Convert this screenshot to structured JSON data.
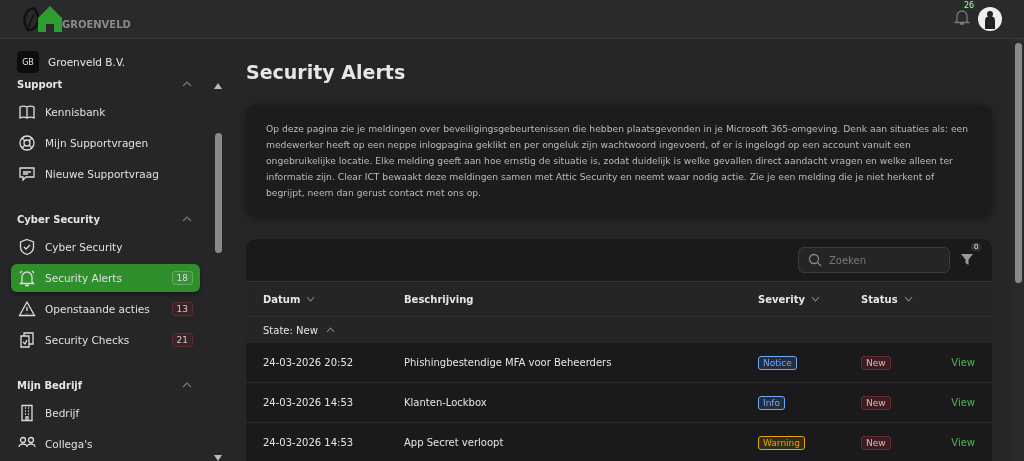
{
  "brand": {
    "name": "GROENVELD"
  },
  "topbar": {
    "notification_count": "26"
  },
  "organization": {
    "initials": "GB",
    "name": "Groenveld B.V."
  },
  "sidebar": {
    "groups": [
      {
        "title": "Support",
        "expanded": true,
        "items": [
          {
            "label": "Kennisbank",
            "selected": false
          },
          {
            "label": "Mijn Supportvragen",
            "selected": false
          },
          {
            "label": "Nieuwe Supportvraag",
            "selected": false
          }
        ]
      },
      {
        "title": "Cyber Security",
        "expanded": true,
        "items": [
          {
            "label": "Cyber Security",
            "selected": false
          },
          {
            "label": "Security Alerts",
            "selected": true,
            "count": "18"
          },
          {
            "label": "Openstaande acties",
            "selected": false,
            "count": "13"
          },
          {
            "label": "Security Checks",
            "selected": false,
            "count": "21"
          }
        ]
      },
      {
        "title": "Mijn Bedrijf",
        "expanded": true,
        "items": [
          {
            "label": "Bedrijf",
            "selected": false
          },
          {
            "label": "Collega's",
            "selected": false
          }
        ]
      }
    ]
  },
  "page": {
    "title": "Security Alerts",
    "description": "Op deze pagina zie je meldingen over beveiligingsgebeurtenissen die hebben plaatsgevonden in je Microsoft 365-omgeving. Denk aan situaties als: een medewerker heeft op een neppe inlogpagina geklikt en per ongeluk zijn wachtwoord ingevoerd, of er is ingelogd op een account vanuit een ongebruikelijke locatie. Elke melding geeft aan hoe ernstig de situatie is, zodat duidelijk is welke gevallen direct aandacht vragen en welke alleen ter informatie zijn. Clear ICT bewaakt deze meldingen samen met Attic Security en neemt waar nodig actie. Zie je een melding die je niet herkent of begrijpt, neem dan gerust contact met ons op."
  },
  "table": {
    "search": {
      "placeholder": "Zoeken"
    },
    "filter_count": "0",
    "columns": [
      {
        "label": "Datum",
        "sortable": true
      },
      {
        "label": "Beschrijving",
        "sortable": false
      },
      {
        "label": "Severity",
        "sortable": true
      },
      {
        "label": "Status",
        "sortable": true
      }
    ],
    "group": {
      "label": "State: New",
      "expanded": true
    },
    "rows": [
      {
        "date": "24-03-2026 20:52",
        "description": "Phishingbestendige MFA voor Beheerders",
        "severity": "Notice",
        "color": "#6ea8fe",
        "status": "New",
        "action": "View"
      },
      {
        "date": "24-03-2026 14:53",
        "description": "Klanten-Lockbox",
        "severity": "Info",
        "color": "#6ea8fe",
        "status": "New",
        "action": "View"
      },
      {
        "date": "24-03-2026 14:53",
        "description": "App Secret verloopt",
        "severity": "Warning",
        "color": "#e0a800",
        "status": "New",
        "action": "View"
      }
    ]
  }
}
